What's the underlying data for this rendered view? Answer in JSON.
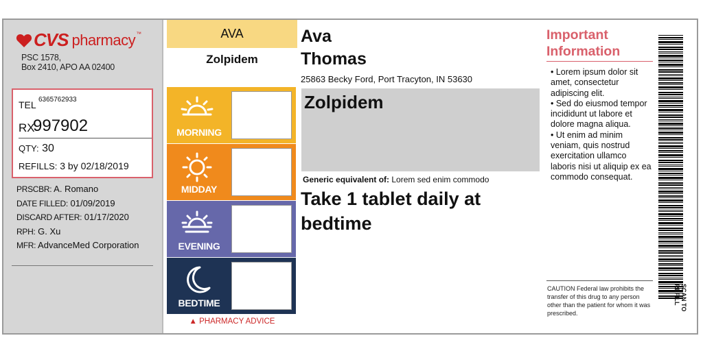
{
  "brand": {
    "name": "CVS",
    "suffix": "pharmacy",
    "color": "#cc1f1f"
  },
  "pharmacy": {
    "address_line1": "PSC 1578,",
    "address_line2": "Box 2410, APO AA 02400"
  },
  "rx": {
    "tel_label": "TEL",
    "tel": "6365762933",
    "rx_label": "RX",
    "rx_number": "997902",
    "qty_label": "QTY:",
    "qty": "30",
    "refills_label": "REFILLS:",
    "refills": "3 by 02/18/2019"
  },
  "details": [
    {
      "label": "PRSCBR:",
      "value": "A. Romano"
    },
    {
      "label": "DATE FILLED:",
      "value": "01/09/2019"
    },
    {
      "label": "DISCARD AFTER:",
      "value": "01/17/2020"
    },
    {
      "label": "RPH:",
      "value": "G. Xu"
    },
    {
      "label": "MFR:",
      "value": "AdvanceMed Corporation"
    }
  ],
  "schedule": {
    "patient_tab": "AVA",
    "drug": "Zolpidem",
    "slots": [
      {
        "label": "MORNING",
        "icon": "sun-icon",
        "color": "#f3b428"
      },
      {
        "label": "MIDDAY",
        "icon": "sun-icon",
        "color": "#f08a1c"
      },
      {
        "label": "EVENING",
        "icon": "sunset-icon",
        "color": "#6668aa"
      },
      {
        "label": "BEDTIME",
        "icon": "moon-icon",
        "color": "#1e3354"
      }
    ],
    "advice": "▲ PHARMACY ADVICE"
  },
  "patient": {
    "first_name": "Ava",
    "last_name": "Thomas",
    "address": "25863 Becky Ford, Port Tracyton, IN 53630"
  },
  "drug": {
    "name": "Zolpidem",
    "generic_label": "Generic equivalent of:",
    "generic_value": "Lorem sed enim commodo",
    "sig": "Take 1 tablet daily at bedtime"
  },
  "important": {
    "title_line1": "Important",
    "title_line2": "Information",
    "bullets": [
      "• Lorem ipsum dolor sit amet, consectetur adipiscing elit.",
      "• Sed do eiusmod tempor incididunt ut labore et dolore magna aliqua.",
      "• Ut enim ad minim veniam, quis nostrud exercitation ullamco laboris nisi ut aliquip ex ea commodo consequat."
    ],
    "caution": "CAUTION Federal law prohibits the transfer of this drug to any person other than the patient for whom it was prescribed."
  },
  "barcode": {
    "scan_label": "SCAN TO REFILL"
  }
}
